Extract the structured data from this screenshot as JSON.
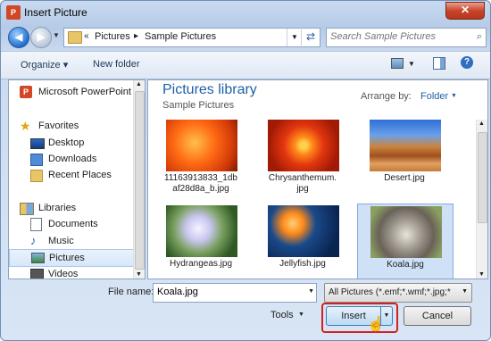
{
  "window": {
    "title": "Insert Picture",
    "app_icon_text": "P",
    "close_glyph": "✕"
  },
  "nav": {
    "back_glyph": "◀",
    "forward_glyph": "▶",
    "breadcrumb": [
      "Pictures",
      "Sample Pictures"
    ],
    "chevron": "«",
    "separator": "▸",
    "search_placeholder": "Search Sample Pictures"
  },
  "toolbar": {
    "organize": "Organize",
    "new_folder": "New folder",
    "help": "?"
  },
  "sidebar": {
    "items": [
      {
        "label": "Microsoft PowerPoint",
        "icon": "powerpoint-icon"
      },
      {
        "label": "Favorites",
        "icon": "star-icon"
      },
      {
        "label": "Desktop",
        "icon": "desktop-icon"
      },
      {
        "label": "Downloads",
        "icon": "downloads-icon"
      },
      {
        "label": "Recent Places",
        "icon": "recent-places-icon"
      },
      {
        "label": "Libraries",
        "icon": "libraries-icon"
      },
      {
        "label": "Documents",
        "icon": "documents-icon"
      },
      {
        "label": "Music",
        "icon": "music-icon"
      },
      {
        "label": "Pictures",
        "icon": "pictures-icon"
      },
      {
        "label": "Videos",
        "icon": "videos-icon"
      }
    ]
  },
  "library": {
    "title": "Pictures library",
    "subtitle": "Sample Pictures",
    "arrange_label": "Arrange by:",
    "arrange_value": "Folder"
  },
  "files": [
    {
      "name": "11163913833_1db\naf28d8a_b.jpg",
      "thumb": "orange-flower"
    },
    {
      "name": "Chrysanthemum.\njpg",
      "thumb": "chrysanthemum"
    },
    {
      "name": "Desert.jpg",
      "thumb": "desert"
    },
    {
      "name": "Hydrangeas.jpg",
      "thumb": "hydrangeas"
    },
    {
      "name": "Jellyfish.jpg",
      "thumb": "jellyfish"
    },
    {
      "name": "Koala.jpg",
      "thumb": "koala"
    }
  ],
  "footer": {
    "file_name_label": "File name:",
    "file_name_value": "Koala.jpg",
    "filter_value": "All Pictures (*.emf;*.wmf;*.jpg;*",
    "tools_label": "Tools",
    "insert_label": "Insert",
    "cancel_label": "Cancel"
  },
  "colors": {
    "accent": "#1e5fa6",
    "highlight_border": "#d32020",
    "selection": "#cfe1f6"
  }
}
